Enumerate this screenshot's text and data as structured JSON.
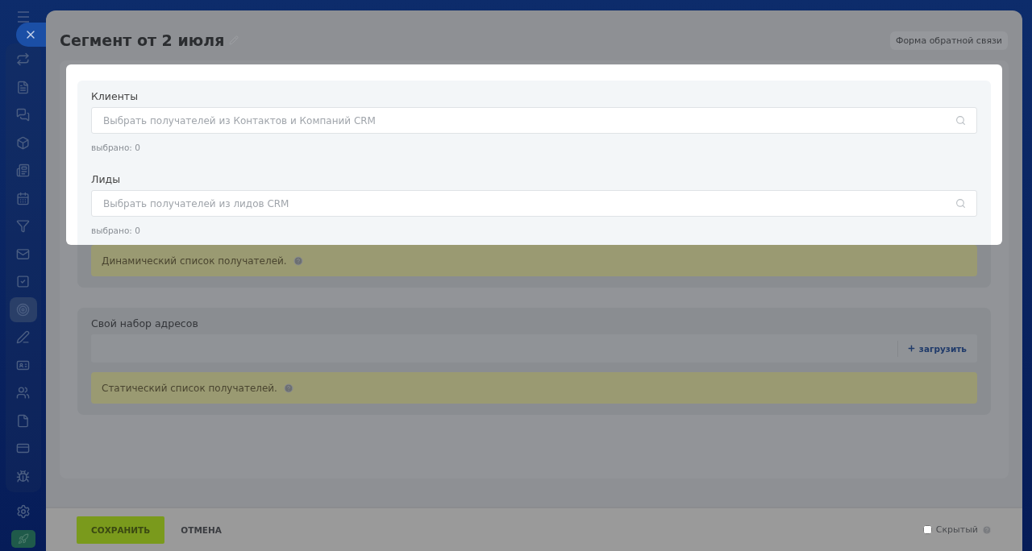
{
  "sidebar": {
    "items": [
      {
        "selected": false
      },
      {
        "selected": false
      },
      {
        "selected": false
      },
      {
        "selected": false
      },
      {
        "selected": false
      },
      {
        "selected": false
      },
      {
        "selected": false
      },
      {
        "selected": false
      },
      {
        "selected": false
      },
      {
        "selected": true
      },
      {
        "selected": false
      },
      {
        "selected": false
      },
      {
        "selected": false
      },
      {
        "selected": false
      },
      {
        "selected": false
      },
      {
        "selected": false
      }
    ]
  },
  "header": {
    "title": "Сегмент от 2 июля",
    "feedback_button": "Форма обратной связи"
  },
  "highlight": {
    "fields": [
      {
        "label": "Клиенты",
        "placeholder": "Выбрать получателей из Контактов и Компаний CRM",
        "selected_count": "выбрано:  0"
      },
      {
        "label": "Лиды",
        "placeholder": "Выбрать получателей из лидов CRM",
        "selected_count": "выбрано:  0"
      }
    ]
  },
  "dynamic_notice": "Динамический список получателей.",
  "custom_addresses": {
    "label": "Свой набор адресов",
    "upload_button": "загрузить",
    "notice": "Статический список получателей."
  },
  "footer": {
    "save": "СОХРАНИТЬ",
    "cancel": "ОТМЕНА",
    "hidden": {
      "label": "Скрытый",
      "checked": false
    }
  }
}
